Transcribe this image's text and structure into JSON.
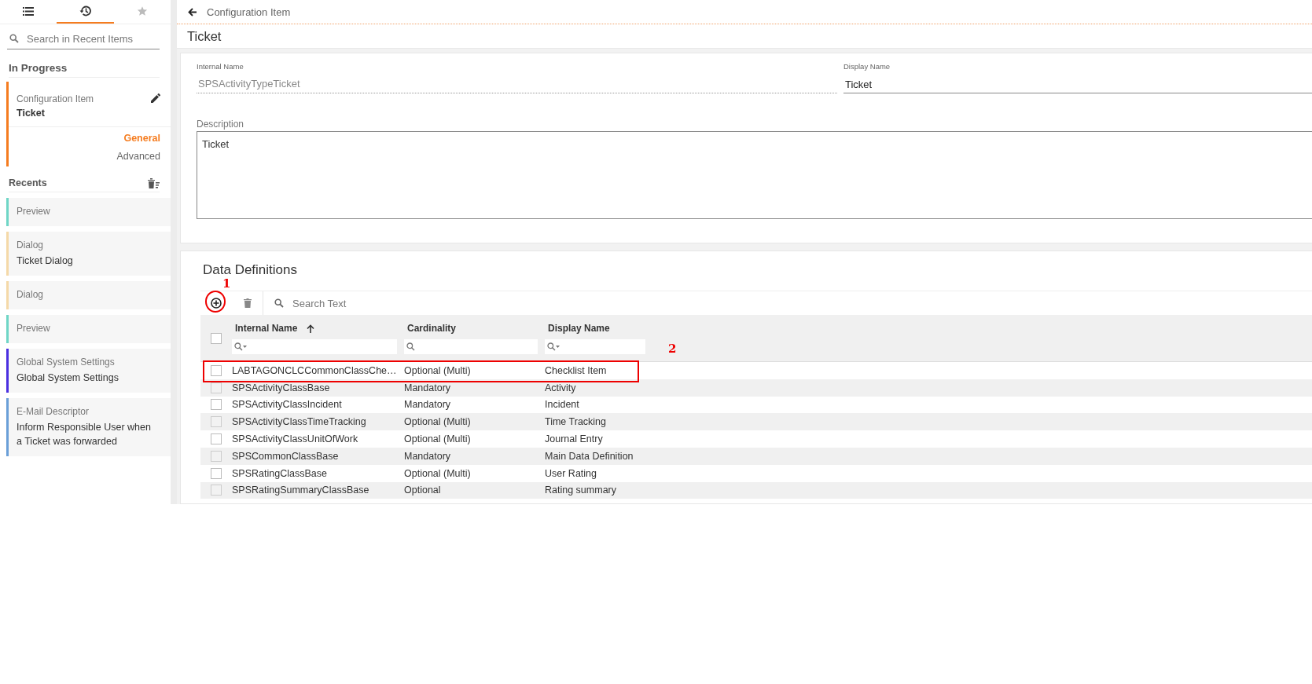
{
  "sidebar": {
    "tabs": [
      {
        "selected": false
      },
      {
        "selected": true
      },
      {
        "selected": false
      }
    ],
    "search": {
      "placeholder": "Search in Recent Items"
    },
    "in_progress": {
      "heading": "In Progress",
      "item": {
        "category": "Configuration Item",
        "title": "Ticket",
        "color": "#f57c1f",
        "sections": [
          {
            "label": "General",
            "selected": true
          },
          {
            "label": "Advanced",
            "selected": false
          }
        ]
      }
    },
    "recents": {
      "heading": "Recents",
      "items": [
        {
          "category": "Preview",
          "color": "#6fd6c6"
        },
        {
          "category": "Dialog",
          "title": "Ticket Dialog",
          "color": "#f5d9a8"
        },
        {
          "category": "Dialog",
          "color": "#f5d9a8"
        },
        {
          "category": "Preview",
          "color": "#6fd6c6"
        },
        {
          "category": "Global System Settings",
          "title": "Global System Settings",
          "color": "#4a2fe0"
        },
        {
          "category": "E-Mail Descriptor",
          "title": "Inform Responsible User when a Ticket was forwarded",
          "color": "#6a9fd8"
        }
      ]
    }
  },
  "header": {
    "breadcrumb": "Configuration Item",
    "title": "Ticket"
  },
  "form": {
    "internal_name": {
      "label": "Internal Name",
      "value": "SPSActivityTypeTicket"
    },
    "display_name": {
      "label": "Display Name",
      "value": "Ticket"
    },
    "description": {
      "label": "Description",
      "value": "Ticket"
    }
  },
  "data_definitions": {
    "title": "Data Definitions",
    "search": {
      "placeholder": "Search Text"
    },
    "select_all": {
      "checked": false
    },
    "columns": [
      {
        "label": "Internal Name",
        "sorted": true
      },
      {
        "label": "Cardinality",
        "sorted": false
      },
      {
        "label": "Display Name",
        "sorted": false
      }
    ],
    "rows": [
      {
        "checked": false,
        "internal_name": "LABTAGONCLCCommonClassChe…",
        "cardinality": "Optional (Multi)",
        "display_name": "Checklist Item"
      },
      {
        "checked": false,
        "internal_name": "SPSActivityClassBase",
        "cardinality": "Mandatory",
        "display_name": "Activity"
      },
      {
        "checked": false,
        "internal_name": "SPSActivityClassIncident",
        "cardinality": "Mandatory",
        "display_name": "Incident"
      },
      {
        "checked": false,
        "internal_name": "SPSActivityClassTimeTracking",
        "cardinality": "Optional (Multi)",
        "display_name": "Time Tracking"
      },
      {
        "checked": false,
        "internal_name": "SPSActivityClassUnitOfWork",
        "cardinality": "Optional (Multi)",
        "display_name": "Journal Entry"
      },
      {
        "checked": false,
        "internal_name": "SPSCommonClassBase",
        "cardinality": "Mandatory",
        "display_name": "Main Data Definition"
      },
      {
        "checked": false,
        "internal_name": "SPSRatingClassBase",
        "cardinality": "Optional (Multi)",
        "display_name": "User Rating"
      },
      {
        "checked": false,
        "internal_name": "SPSRatingSummaryClassBase",
        "cardinality": "Optional",
        "display_name": "Rating summary"
      }
    ]
  },
  "annotations": [
    {
      "kind": "circle",
      "label": "1"
    },
    {
      "kind": "rectangle",
      "label": "2"
    }
  ]
}
